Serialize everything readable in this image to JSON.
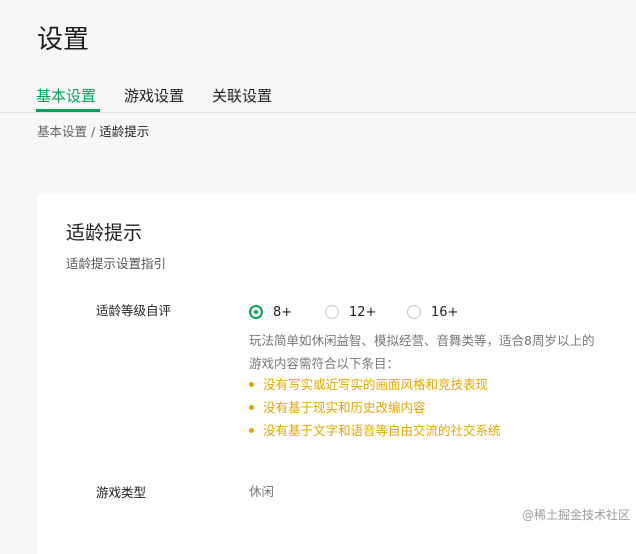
{
  "page": {
    "title": "设置"
  },
  "tabs": [
    {
      "label": "基本设置",
      "active": true
    },
    {
      "label": "游戏设置",
      "active": false
    },
    {
      "label": "关联设置",
      "active": false
    }
  ],
  "breadcrumb": {
    "parent": "基本设置",
    "separator": "/",
    "current": "适龄提示"
  },
  "card": {
    "title": "适龄提示",
    "subtitle": "适龄提示设置指引",
    "age_rating": {
      "label": "适龄等级自评",
      "options": [
        {
          "label": "8+",
          "checked": true
        },
        {
          "label": "12+",
          "checked": false
        },
        {
          "label": "16+",
          "checked": false
        }
      ],
      "description_line1": "玩法简单如休闲益智、模拟经营、音舞类等，适合8周岁以上的",
      "description_line2": "游戏内容需符合以下条目：",
      "requirements": [
        "没有写实或近写实的画面风格和竞技表现",
        "没有基于现实和历史改编内容",
        "没有基于文字和语音等自由交流的社交系统"
      ]
    },
    "game_type": {
      "label": "游戏类型",
      "value": "休闲"
    }
  },
  "watermark": "@稀土掘金技术社区",
  "colors": {
    "accent": "#07a35a",
    "warning": "#e5a600",
    "background": "#f7f7f7",
    "card": "#ffffff"
  }
}
